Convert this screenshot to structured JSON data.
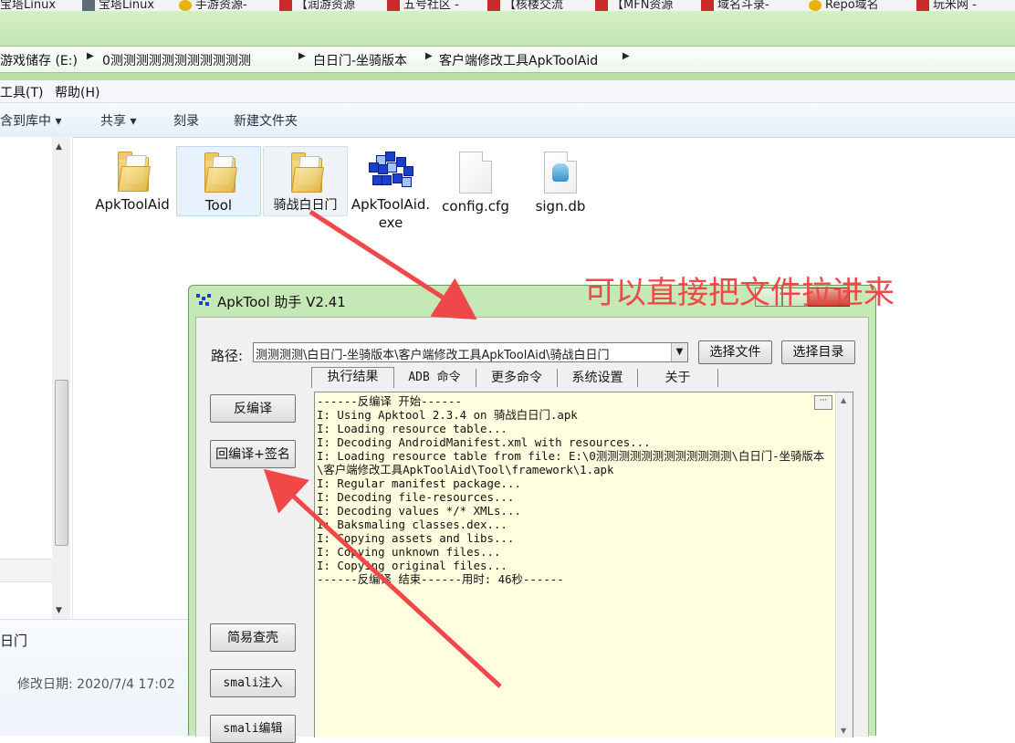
{
  "bookmarks": [
    "宝塔Linux",
    "宝塔Linux",
    "手游资源-",
    "【润游资源",
    "五号社区 -",
    "【核楼交流",
    "【MFN资源",
    "域名斗录-",
    "Repo域名",
    "玩米网 -"
  ],
  "address": {
    "crumbs": [
      "游戏储存 (E:)",
      "0测测测测测测测测测测测",
      "白日门-坐骑版本",
      "客户端修改工具ApkToolAid"
    ],
    "separator": "▶"
  },
  "menubar": {
    "tools": "工具(T)",
    "help": "帮助(H)"
  },
  "toolbar": {
    "include": "含到库中 ▾",
    "share": "共享 ▾",
    "burn": "刻录",
    "new_folder": "新建文件夹"
  },
  "files": [
    {
      "name": "ApkToolAid",
      "icon": "folder-icon"
    },
    {
      "name": "Tool",
      "icon": "folder-icon"
    },
    {
      "name": "骑战白日门",
      "icon": "folder-icon"
    },
    {
      "name": "ApkToolAid.exe",
      "icon": "exe-icon"
    },
    {
      "name": "config.cfg",
      "icon": "document-icon"
    },
    {
      "name": "sign.db",
      "icon": "database-file-icon"
    }
  ],
  "details": {
    "name": "日门",
    "modified": "修改日期: 2020/7/4 17:02"
  },
  "annotation": "可以直接把文件拉进来",
  "dialog": {
    "title": "ApkTool 助手 V2.41",
    "path_label": "路径:",
    "path_value": "测测测测\\白日门-坐骑版本\\客户端修改工具ApkToolAid\\骑战白日门",
    "select_file": "选择文件",
    "select_dir": "选择目录",
    "tabs": [
      "执行结果",
      "ADB 命令",
      "更多命令",
      "系统设置",
      "关于"
    ],
    "side_buttons": [
      "反编译",
      "回编译+签名",
      "简易查壳",
      "smali注入",
      "smali编辑"
    ],
    "log": "------反编译 开始------\nI: Using Apktool 2.3.4 on 骑战白日门.apk\nI: Loading resource table...\nI: Decoding AndroidManifest.xml with resources...\nI: Loading resource table from file: E:\\0测测测测测测测测测测测测\\白日门-坐骑版本\\客户端修改工具ApkToolAid\\Tool\\framework\\1.apk\nI: Regular manifest package...\nI: Decoding file-resources...\nI: Decoding values */* XMLs...\nI: Baksmaling classes.dex...\nI: Copying assets and libs...\nI: Copying unknown files...\nI: Copying original files...\n------反编译 结束------用时: 46秒------"
  },
  "colors": {
    "glass": "#c3e7b3",
    "annotation": "#f04848",
    "log_bg": "#ffffe0"
  }
}
